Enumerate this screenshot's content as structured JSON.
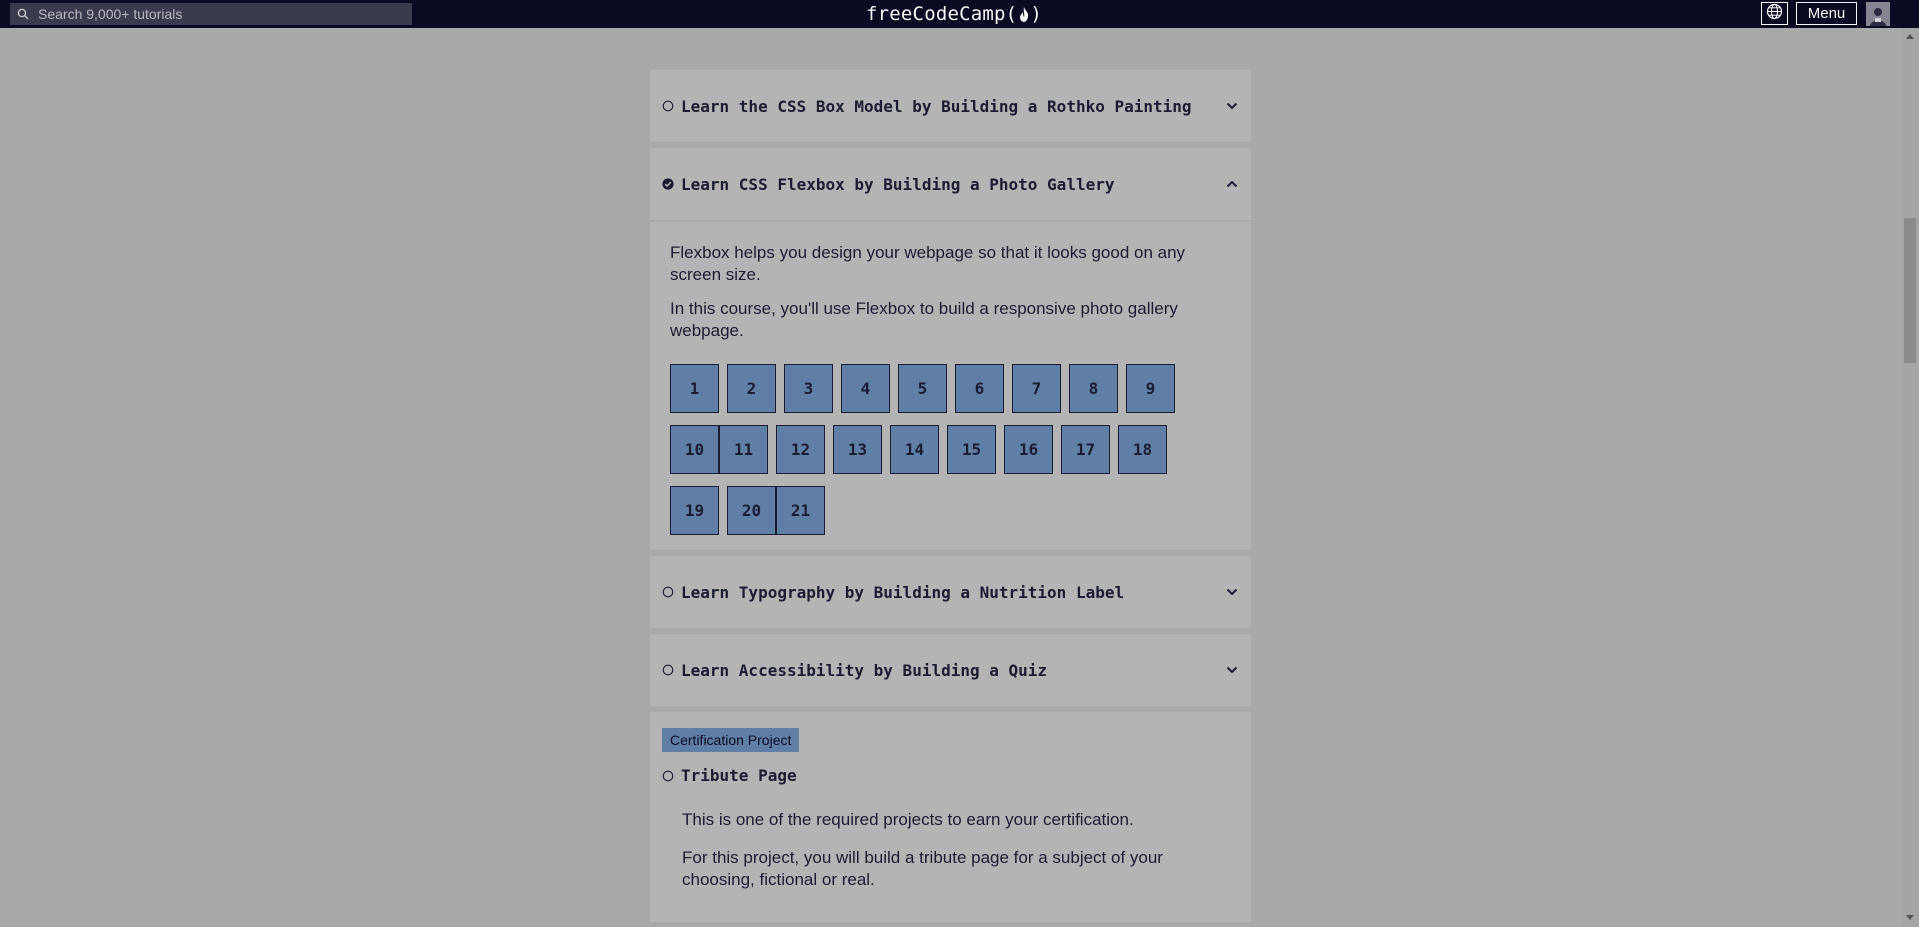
{
  "navbar": {
    "search_placeholder": "Search 9,000+ tutorials",
    "logo_text": "freeCodeCamp(",
    "logo_end": ")",
    "menu_label": "Menu"
  },
  "blocks": [
    {
      "title": "Learn the CSS Box Model by Building a Rothko Painting",
      "completed": false,
      "expanded": false
    },
    {
      "title": "Learn CSS Flexbox by Building a Photo Gallery",
      "completed": true,
      "expanded": true,
      "description": [
        "Flexbox helps you design your webpage so that it looks good on any screen size.",
        "In this course, you'll use Flexbox to build a responsive photo gallery webpage."
      ],
      "steps": [
        "1",
        "2",
        "3",
        "4",
        "5",
        "6",
        "7",
        "8",
        "9",
        "10",
        "11",
        "12",
        "13",
        "14",
        "15",
        "16",
        "17",
        "18",
        "19",
        "20",
        "21"
      ]
    },
    {
      "title": "Learn Typography by Building a Nutrition Label",
      "completed": false,
      "expanded": false
    },
    {
      "title": "Learn Accessibility by Building a Quiz",
      "completed": false,
      "expanded": false
    }
  ],
  "cert_project": {
    "badge": "Certification Project",
    "title": "Tribute Page",
    "completed": false,
    "description": [
      "This is one of the required projects to earn your certification.",
      "For this project, you will build a tribute page for a subject of your choosing, fictional or real."
    ]
  },
  "colors": {
    "overlay_bg": "#a9a9aa",
    "navbar_bg": "#0a0a23",
    "step_bg": "#5f7fa6",
    "text": "#1b1b32"
  },
  "icons": {
    "search": "magnifier-icon",
    "flame": "flame-icon",
    "language": "globe-icon",
    "avatar": "user-avatar-icon",
    "incomplete": "empty-circle-icon",
    "complete": "check-circle-icon",
    "expand": "chevron-down-icon",
    "collapse": "chevron-up-icon"
  }
}
